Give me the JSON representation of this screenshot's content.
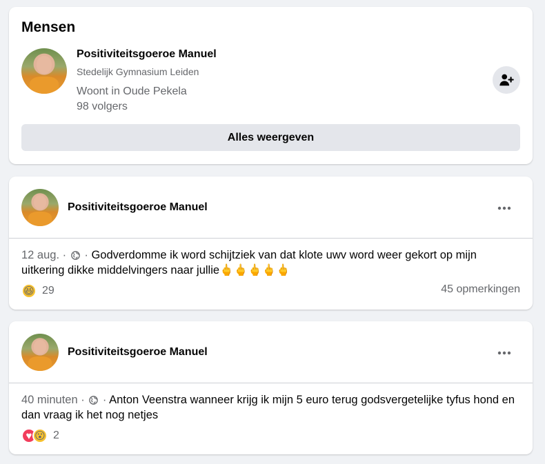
{
  "people_section": {
    "title": "Mensen",
    "person": {
      "name": "Positiviteitsgoeroe Manuel",
      "school": "Stedelijk Gymnasium Leiden",
      "location": "Woont in Oude Pekela",
      "followers": "98 volgers"
    },
    "show_all_label": "Alles weergeven"
  },
  "posts": [
    {
      "author": "Positiviteitsgoeroe Manuel",
      "time": "12 aug.",
      "sep": "·",
      "text": "Godverdomme ik word schijtziek van dat klote uwv word weer gekort op mijn uitkering dikke middelvingers naar jullie🖕🖕🖕🖕🖕",
      "reaction_count": "29",
      "comments": "45 opmerkingen"
    },
    {
      "author": "Positiviteitsgoeroe Manuel",
      "time": "40 minuten",
      "sep": "·",
      "text": "Anton Veenstra wanneer krijg ik mijn 5 euro terug godsvergetelijke tyfus hond en dan vraag ik het nog netjes",
      "reaction_count": "2"
    }
  ],
  "icons": {
    "add_friend": "add-friend-icon",
    "more": "more-options-icon",
    "globe": "globe-icon",
    "haha": "haha-reaction-icon",
    "love": "love-reaction-icon",
    "wow": "wow-reaction-icon"
  },
  "colors": {
    "background": "#f0f2f5",
    "card": "#ffffff",
    "secondary_text": "#65676b",
    "button_grey": "#e4e6eb"
  }
}
